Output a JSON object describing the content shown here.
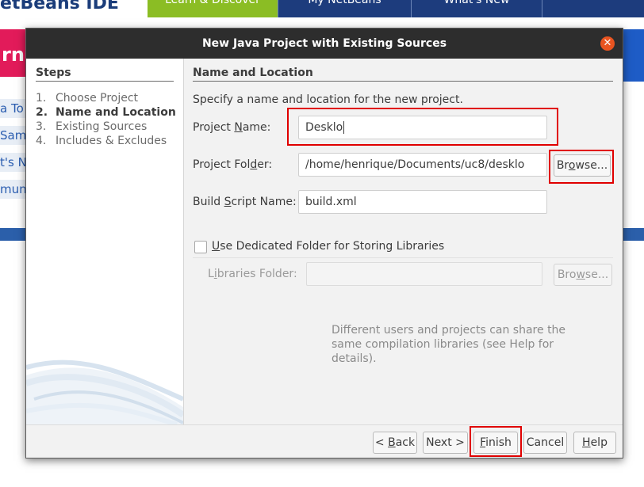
{
  "background": {
    "brand": "etBeans IDE",
    "tabs": [
      "Learn & Discover",
      "My NetBeans",
      "What's New"
    ],
    "hero_fragment": "rn",
    "links": [
      "a To",
      "Sam",
      "t's N",
      "mun"
    ]
  },
  "dialog": {
    "title": "New Java Project with Existing Sources",
    "steps_title": "Steps",
    "steps": [
      {
        "num": "1.",
        "label": "Choose Project"
      },
      {
        "num": "2.",
        "label": "Name and Location"
      },
      {
        "num": "3.",
        "label": "Existing Sources"
      },
      {
        "num": "4.",
        "label": "Includes & Excludes"
      }
    ],
    "section_title": "Name and Location",
    "intro": "Specify a name and location for the new project.",
    "project_name": {
      "label_pre": "Project ",
      "label_key": "N",
      "label_post": "ame:",
      "value": "Desklo"
    },
    "project_folder": {
      "label_pre": "Project Fol",
      "label_key": "d",
      "label_post": "er:",
      "value": "/home/henrique/Documents/uc8/desklo"
    },
    "build_script": {
      "label_pre": "Build ",
      "label_key": "S",
      "label_post": "cript Name:",
      "value": "build.xml"
    },
    "browse": {
      "pre": "Br",
      "key": "o",
      "post": "wse..."
    },
    "use_dedicated": {
      "pre": "",
      "key": "U",
      "post": "se Dedicated Folder for Storing Libraries",
      "checked": false
    },
    "libraries_folder": {
      "pre": "L",
      "key": "i",
      "post": "braries Folder:",
      "value": ""
    },
    "libraries_browse": {
      "pre": "Bro",
      "key": "w",
      "post": "se..."
    },
    "libraries_note": "Different users and projects can share the same compilation libraries (see Help for details).",
    "buttons": {
      "back": {
        "pre": "< ",
        "key": "B",
        "post": "ack"
      },
      "next": {
        "label": "Next >"
      },
      "finish": {
        "pre": "",
        "key": "F",
        "post": "inish"
      },
      "cancel": {
        "label": "Cancel"
      },
      "help": {
        "pre": "",
        "key": "H",
        "post": "elp"
      }
    }
  },
  "colors": {
    "highlight": "#e00000",
    "close_button": "#e95420",
    "titlebar": "#2d2d2d"
  }
}
